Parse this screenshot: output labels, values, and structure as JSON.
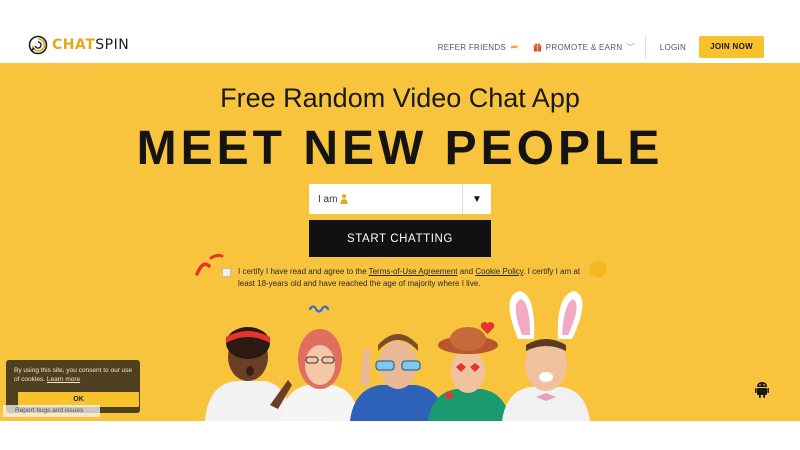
{
  "brand": {
    "chat": "CHAT",
    "spin": "SPIN"
  },
  "nav": {
    "refer": "REFER FRIENDS",
    "promote": "PROMOTE & EARN",
    "login": "LOGIN",
    "join": "JOIN NOW"
  },
  "hero": {
    "subtitle": "Free Random Video Chat App",
    "title": "MEET NEW PEOPLE",
    "gender_select": {
      "label": "I am"
    },
    "start_button": "START CHATTING"
  },
  "certify": {
    "part1": "I certify I have read and agree to the ",
    "terms_link": "Terms-of-Use Agreement",
    "and": " and ",
    "cookie_link": "Cookie Policy",
    "part2": ". I certify I am at least 18-years old and have reached the age of majority where I live."
  },
  "cookie_banner": {
    "text": "By using this site, you consent to our use of cookies. ",
    "learn_more": "Learn more",
    "ok": "OK"
  },
  "report": "Report bugs and issues",
  "colors": {
    "accent": "#f8c43e",
    "button_dark": "#111111",
    "join": "#f8c22c"
  },
  "icons": [
    "logo-icon",
    "arrow-right-icon",
    "gift-icon",
    "chevron-down-icon",
    "person-icon",
    "caret-down-icon",
    "android-icon"
  ]
}
